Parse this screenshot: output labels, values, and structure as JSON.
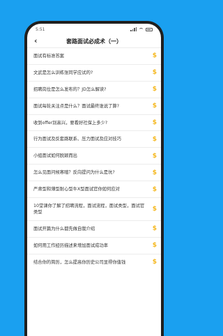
{
  "status": {
    "time": "5:51"
  },
  "header": {
    "title": "套路面试必成术（一）"
  },
  "items": [
    "面试有标准答案",
    "文武是怎么训练张同学应试的?",
    "招聘岗位是怎么发布的？JD怎么解读?",
    "面试每轮关注点是什么？面试最终谁说了算?",
    "收到offer别高兴，要看好社保上多少?",
    "行为面试及反套路联系、压力面试及应对技巧",
    "小组面试如何脱颖而出",
    "怎么见面问候寒暄？反向提问为什么是坑?",
    "严肃型和薄型耐心型牛X型面试官你如何应对",
    "10堂课你了解了招聘流程，面试流程，面试类型，面试官类型",
    "面试开篇为什么都先做自我介绍",
    "如何用工作经历描述来增加面试成功率",
    "结合你的简历，怎么提高你历史公司显得你值钱"
  ],
  "item_icon": "dollar-icon",
  "colors": {
    "background": "#1aa0f0",
    "accent": "#f5b820"
  }
}
